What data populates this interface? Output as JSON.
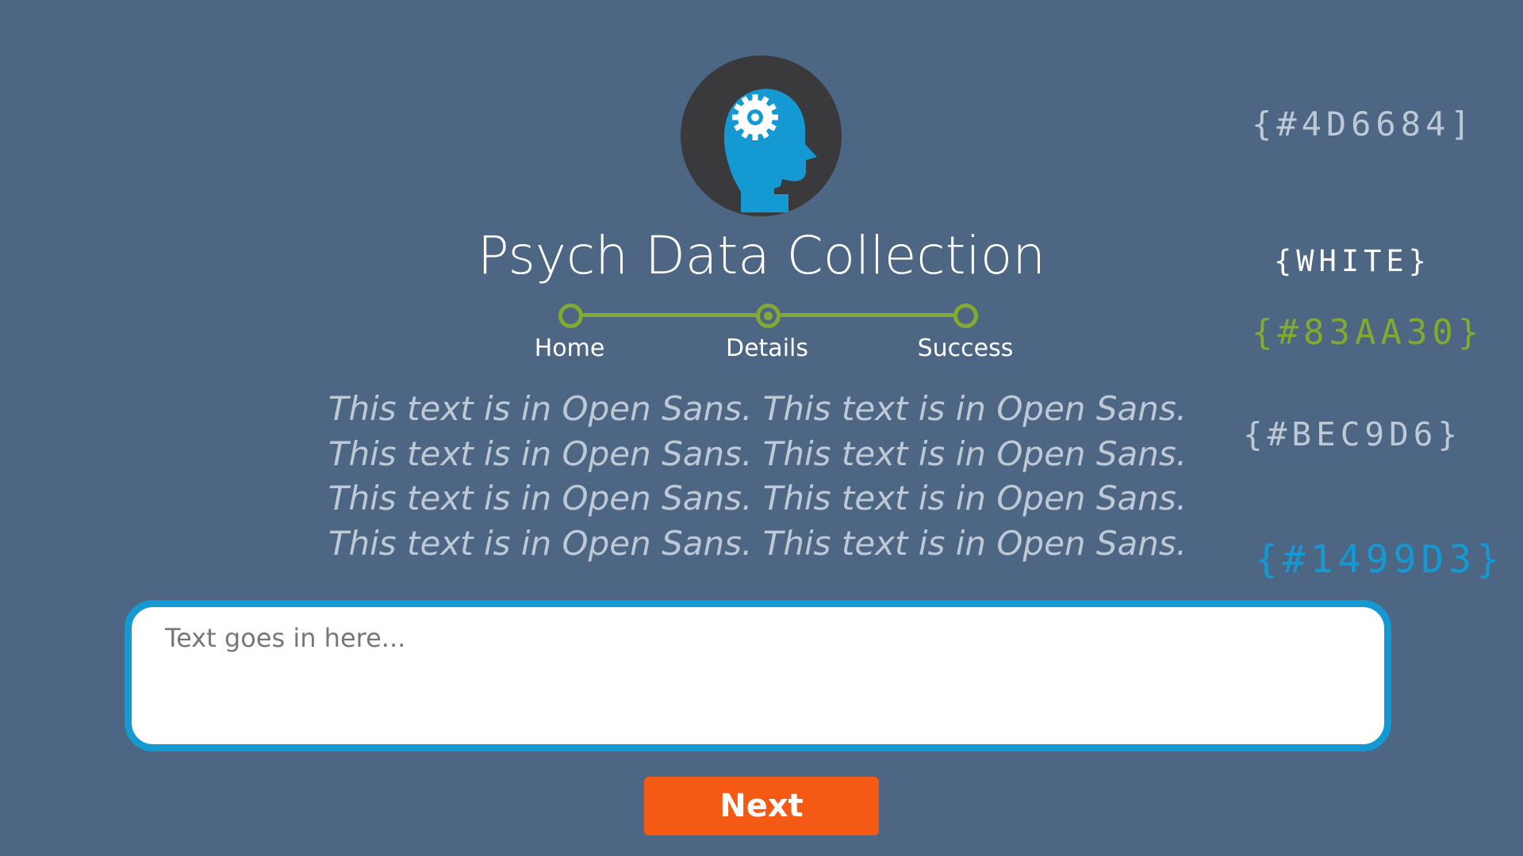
{
  "app": {
    "title": "Psych Data Collection",
    "logo_icon": "head-gear-icon"
  },
  "steps": [
    {
      "label": "Home",
      "active": false
    },
    {
      "label": "Details",
      "active": true
    },
    {
      "label": "Success",
      "active": false
    }
  ],
  "paragraph": {
    "lines": [
      "This text is in Open Sans. This text is in Open Sans.",
      "This text is in Open Sans. This text is in Open Sans.",
      "This text is in Open Sans. This text is in Open Sans.",
      "This text is in Open Sans. This text is in Open Sans."
    ]
  },
  "color_labels": {
    "background": "{#4D6684]",
    "white": "{WHITE}",
    "green": "{#83AA30}",
    "grey_blue": "{#BEC9D6}",
    "blue": "{#1499D3}"
  },
  "input": {
    "placeholder": "Text goes in here...",
    "value": ""
  },
  "next_button": {
    "label": "Next"
  },
  "colors": {
    "background": "#4d6684",
    "white": "#ffffff",
    "accent_green": "#83aa30",
    "text_grey_blue": "#bec9d6",
    "accent_blue": "#1499d3",
    "button_orange": "#f55a14",
    "logo_dark": "#3a3a3c"
  }
}
